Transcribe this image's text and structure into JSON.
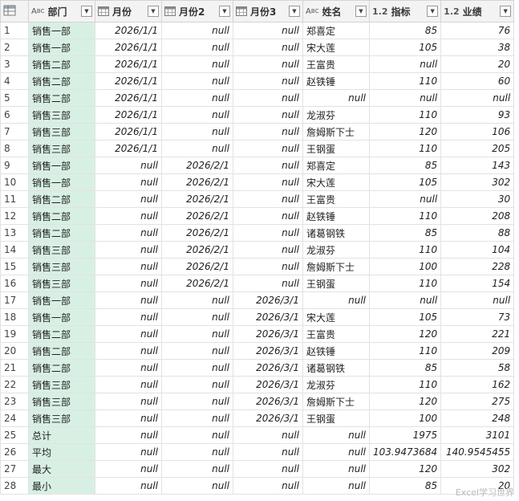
{
  "table": {
    "columns": [
      {
        "name": "部门",
        "type": "ABC"
      },
      {
        "name": "月份",
        "type": "date"
      },
      {
        "name": "月份2",
        "type": "date"
      },
      {
        "name": "月份3",
        "type": "date"
      },
      {
        "name": "姓名",
        "type": "ABC"
      },
      {
        "name": "指标",
        "type": "1.2"
      },
      {
        "name": "业绩",
        "type": "1.2"
      }
    ],
    "rows": [
      [
        "1",
        "销售一部",
        "2026/1/1",
        "null",
        "null",
        "郑喜定",
        "85",
        "76"
      ],
      [
        "2",
        "销售一部",
        "2026/1/1",
        "null",
        "null",
        "宋大莲",
        "105",
        "38"
      ],
      [
        "3",
        "销售二部",
        "2026/1/1",
        "null",
        "null",
        "王富贵",
        "null",
        "20"
      ],
      [
        "4",
        "销售二部",
        "2026/1/1",
        "null",
        "null",
        "赵铁锤",
        "110",
        "60"
      ],
      [
        "5",
        "销售二部",
        "2026/1/1",
        "null",
        "null",
        "null",
        "null",
        "null"
      ],
      [
        "6",
        "销售三部",
        "2026/1/1",
        "null",
        "null",
        "龙淑芬",
        "110",
        "93"
      ],
      [
        "7",
        "销售三部",
        "2026/1/1",
        "null",
        "null",
        "詹姆斯下士",
        "120",
        "106"
      ],
      [
        "8",
        "销售三部",
        "2026/1/1",
        "null",
        "null",
        "王钢蛋",
        "110",
        "205"
      ],
      [
        "9",
        "销售一部",
        "null",
        "2026/2/1",
        "null",
        "郑喜定",
        "85",
        "143"
      ],
      [
        "10",
        "销售一部",
        "null",
        "2026/2/1",
        "null",
        "宋大莲",
        "105",
        "302"
      ],
      [
        "11",
        "销售二部",
        "null",
        "2026/2/1",
        "null",
        "王富贵",
        "null",
        "30"
      ],
      [
        "12",
        "销售二部",
        "null",
        "2026/2/1",
        "null",
        "赵铁锤",
        "110",
        "208"
      ],
      [
        "13",
        "销售二部",
        "null",
        "2026/2/1",
        "null",
        "诸葛钢铁",
        "85",
        "88"
      ],
      [
        "14",
        "销售三部",
        "null",
        "2026/2/1",
        "null",
        "龙淑芬",
        "110",
        "104"
      ],
      [
        "15",
        "销售三部",
        "null",
        "2026/2/1",
        "null",
        "詹姆斯下士",
        "100",
        "228"
      ],
      [
        "16",
        "销售三部",
        "null",
        "2026/2/1",
        "null",
        "王钢蛋",
        "110",
        "154"
      ],
      [
        "17",
        "销售一部",
        "null",
        "null",
        "2026/3/1",
        "null",
        "null",
        "null"
      ],
      [
        "18",
        "销售一部",
        "null",
        "null",
        "2026/3/1",
        "宋大莲",
        "105",
        "73"
      ],
      [
        "19",
        "销售二部",
        "null",
        "null",
        "2026/3/1",
        "王富贵",
        "120",
        "221"
      ],
      [
        "20",
        "销售二部",
        "null",
        "null",
        "2026/3/1",
        "赵铁锤",
        "110",
        "209"
      ],
      [
        "21",
        "销售二部",
        "null",
        "null",
        "2026/3/1",
        "诸葛钢铁",
        "85",
        "58"
      ],
      [
        "22",
        "销售三部",
        "null",
        "null",
        "2026/3/1",
        "龙淑芬",
        "110",
        "162"
      ],
      [
        "23",
        "销售三部",
        "null",
        "null",
        "2026/3/1",
        "詹姆斯下士",
        "120",
        "275"
      ],
      [
        "24",
        "销售三部",
        "null",
        "null",
        "2026/3/1",
        "王钢蛋",
        "100",
        "248"
      ],
      [
        "25",
        "总计",
        "null",
        "null",
        "null",
        "null",
        "1975",
        "3101"
      ],
      [
        "26",
        "平均",
        "null",
        "null",
        "null",
        "null",
        "103.9473684",
        "140.9545455"
      ],
      [
        "27",
        "最大",
        "null",
        "null",
        "null",
        "null",
        "120",
        "302"
      ],
      [
        "28",
        "最小",
        "null",
        "null",
        "null",
        "null",
        "85",
        "20"
      ]
    ]
  },
  "watermark": "Excel学习世界",
  "colors": {
    "dept_bg": "#d8f0e4",
    "header_bg": "#f3f3f3",
    "grid_line": "#e2e2e2"
  }
}
